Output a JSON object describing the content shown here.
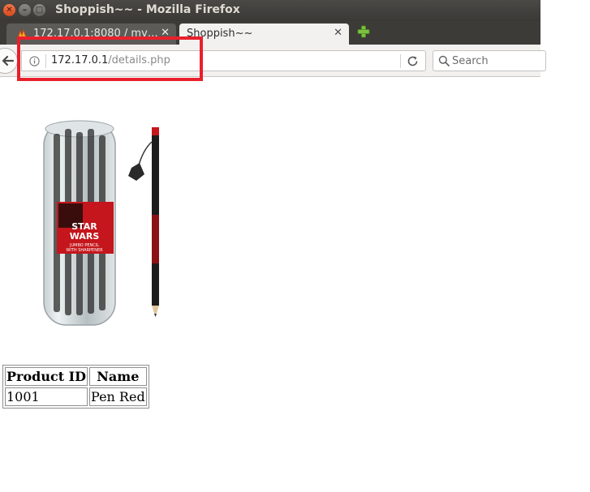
{
  "window": {
    "title": "Shoppish~~ - Mozilla Firefox"
  },
  "tabs": [
    {
      "label": "172.17.0.1:8080 / mv…",
      "active": false
    },
    {
      "label": "Shoppish~~",
      "active": true
    }
  ],
  "urlbar": {
    "host": "172.17.0.1",
    "path": "/details.php"
  },
  "search": {
    "placeholder": "Search"
  },
  "product": {
    "image_icon": "star-wars-pencil-product-image",
    "image_label": "STAR WARS",
    "image_caption": "JUMBO PENCIL WITH SHARPENER",
    "table": {
      "headers": [
        "Product ID",
        "Name"
      ],
      "rows": [
        [
          "1001",
          "Pen Red"
        ]
      ]
    }
  },
  "colors": {
    "highlight": "#e8202c",
    "titlebar": "#3c3b37",
    "tab_active": "#f2f1f0"
  }
}
